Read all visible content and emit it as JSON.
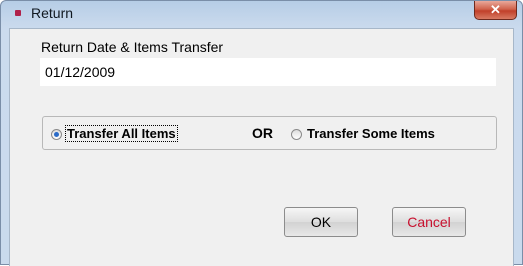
{
  "window": {
    "title": "Return",
    "close_label": "✕"
  },
  "form": {
    "date_label": "Return Date & Items Transfer",
    "date_value": "01/12/2009",
    "option_all": "Transfer All Items",
    "or_text": "OR",
    "option_some": "Transfer Some Items",
    "selected_option": "Transfer All Items"
  },
  "buttons": {
    "ok_label": "OK",
    "cancel_label": "Cancel"
  },
  "colors": {
    "accent": "#b0214a",
    "cancel_text": "#c8102e",
    "close_button": "#c1402a"
  }
}
